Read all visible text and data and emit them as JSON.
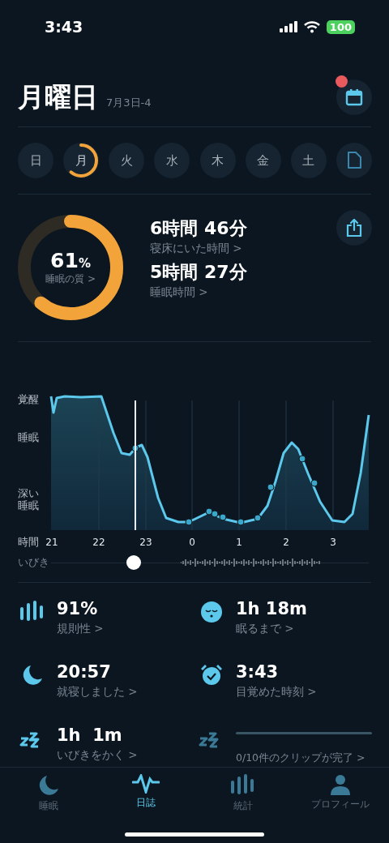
{
  "status_bar": {
    "time": "3:43",
    "battery": "100"
  },
  "header": {
    "title": "月曜日",
    "date": "7月3日-4",
    "calendar_badge": true
  },
  "days": [
    {
      "label": "日",
      "selected": false
    },
    {
      "label": "月",
      "selected": true
    },
    {
      "label": "火",
      "selected": false
    },
    {
      "label": "水",
      "selected": false
    },
    {
      "label": "木",
      "selected": false
    },
    {
      "label": "金",
      "selected": false
    },
    {
      "label": "土",
      "selected": false
    }
  ],
  "quality": {
    "value": "61",
    "unit": "%",
    "label": "睡眠の質 >"
  },
  "durations": [
    {
      "value": "6時間 46分",
      "label": "寝床にいた時間 >"
    },
    {
      "value": "5時間 27分",
      "label": "睡眠時間 >"
    }
  ],
  "hypnogram": {
    "y_labels": [
      "覚醒",
      "睡眠",
      "深い睡眠"
    ],
    "x_title": "時間",
    "hours": [
      "21",
      "22",
      "23",
      "0",
      "1",
      "2",
      "3"
    ],
    "snore_label": "いびき",
    "snore_position": {
      "level": 0.26
    }
  },
  "stats": [
    {
      "kind": "stat",
      "value": "91%",
      "label": "規則性 >"
    },
    {
      "kind": "stat",
      "value": "1h 18m",
      "label": "眠るまで >"
    },
    {
      "kind": "stat",
      "value": "20:57",
      "label": "就寝しました >"
    },
    {
      "kind": "stat",
      "value": "3:43",
      "label": "目覚めた時刻 >"
    },
    {
      "kind": "stat",
      "value": "1h  1m",
      "label": "いびきをかく >"
    },
    {
      "kind": "progress",
      "level": 0,
      "label": "0/10件のクリップが完了 >"
    }
  ],
  "tabs": [
    {
      "label": "睡眠",
      "selected": false
    },
    {
      "label": "日誌",
      "selected": true
    },
    {
      "label": "統計",
      "selected": false
    },
    {
      "label": "プロフィール",
      "selected": false
    }
  ]
}
